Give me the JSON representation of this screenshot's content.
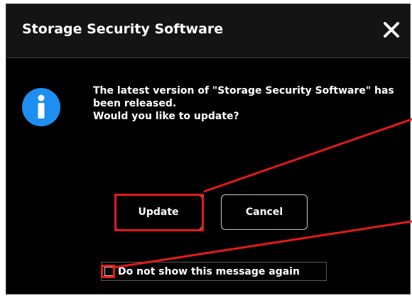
{
  "dialog": {
    "title": "Storage Security Software",
    "close_icon": "close-icon",
    "info_icon": "info-icon",
    "message_lines": [
      "The latest version of \"Storage Security Software\" has",
      "been released.",
      "Would you like to update?"
    ],
    "buttons": {
      "update_label": "Update",
      "cancel_label": "Cancel"
    },
    "checkbox": {
      "label": "Do not show this message again",
      "checked": false
    }
  },
  "colors": {
    "dialog_background": "#000000",
    "titlebar_background": "#141414",
    "info_icon_blue": "#1e8ff0",
    "highlight_red": "#e21b1b",
    "text": "#ffffff"
  }
}
